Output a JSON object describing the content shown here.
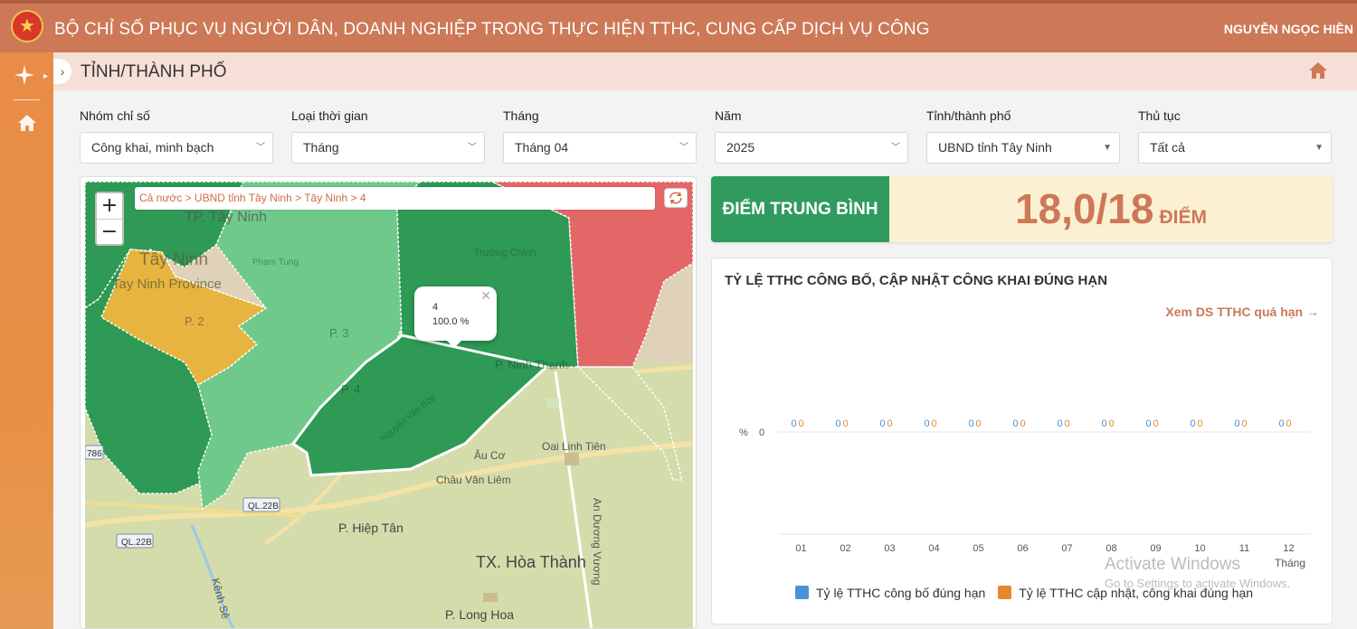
{
  "header": {
    "title": "BỘ CHỈ SỐ PHỤC VỤ NGƯỜI DÂN, DOANH NGHIỆP TRONG THỰC HIỆN TTHC, CUNG CẤP DỊCH VỤ CÔNG",
    "user": "NGUYỄN NGỌC HIỀN",
    "emblem_icon": "national-emblem-icon"
  },
  "sidebar": {
    "items": [
      {
        "icon": "menu-compass-icon"
      },
      {
        "icon": "home-icon"
      }
    ]
  },
  "subheader": {
    "title": "TỈNH/THÀNH PHỐ",
    "home_icon": "home-icon"
  },
  "filters": [
    {
      "label": "Nhóm chỉ số",
      "value": "Công khai, minh bạch"
    },
    {
      "label": "Loại thời gian",
      "value": "Tháng"
    },
    {
      "label": "Tháng",
      "value": "Tháng 04"
    },
    {
      "label": "Năm",
      "value": "2025"
    },
    {
      "label": "Tỉnh/thành phố",
      "value": "UBND tỉnh Tây Ninh"
    },
    {
      "label": "Thủ tục",
      "value": "Tất cả"
    }
  ],
  "map": {
    "breadcrumb": "Cả nước > UBND tỉnh Tây Ninh > Tây Ninh > 4",
    "zoom_in": "+",
    "zoom_out": "−",
    "popup": {
      "name": "4",
      "value": "100.0 %"
    },
    "labels": {
      "tp_tay_ninh": "TP. Tây Ninh",
      "tay_ninh": "Tây Ninh",
      "tay_ninh_province": "Tay Ninh Province",
      "p2": "P. 2",
      "p3": "P. 3",
      "p4": "P. 4",
      "ninh_thanh": "P. Ninh Thạnh",
      "hiep_tan": "P. Hiệp Tân",
      "hoa_thanh": "TX. Hòa Thành",
      "long_hoa": "P. Long Hoa",
      "truong_chinh": "Trường Chinh",
      "au_co": "Âu Cơ",
      "oai_linh_tien": "Oai Linh Tiên",
      "chau_van_liem": "Châu Văn Liêm",
      "an_duong_vuong": "An Dương Vương",
      "kenh": "Kênh Sê",
      "ql22b_1": "QL.22B",
      "ql22b_2": "QL.22B",
      "r786": "786",
      "pham_tung": "Phạm Tung",
      "nguyen_van_bot": "Nguyễn Văn Bộp"
    },
    "colors": {
      "dark_green": "#2e9a55",
      "green": "#4bb26d",
      "light_green": "#6fc98b",
      "yellow": "#e7b43f",
      "red": "#e46767"
    }
  },
  "score": {
    "label": "ĐIỂM TRUNG BÌNH",
    "value": "18,0/18",
    "unit": "ĐIỂM"
  },
  "chart_panel": {
    "title": "TỶ LỆ TTHC CÔNG BỐ, CẬP NHẬT CÔNG KHAI ĐÚNG HẠN",
    "link": "Xem DS TTHC quá hạn →",
    "watermark_title": "Activate Windows",
    "watermark_sub": "Go to Settings to activate Windows."
  },
  "chart_data": {
    "type": "bar",
    "categories": [
      "01",
      "02",
      "03",
      "04",
      "05",
      "06",
      "07",
      "08",
      "09",
      "10",
      "11",
      "12"
    ],
    "series": [
      {
        "name": "Tỷ lệ TTHC công bố đúng hạn",
        "values": [
          0,
          0,
          0,
          0,
          0,
          0,
          0,
          0,
          0,
          0,
          0,
          0
        ],
        "color": "#4a90d9"
      },
      {
        "name": "Tỷ lệ TTHC cập nhật, công khai đúng hạn",
        "values": [
          0,
          0,
          0,
          0,
          0,
          0,
          0,
          0,
          0,
          0,
          0,
          0
        ],
        "color": "#e8882c"
      }
    ],
    "xlabel": "Tháng",
    "ylabel": "%",
    "y_ticks": [
      "0"
    ],
    "legend": "bottom"
  }
}
